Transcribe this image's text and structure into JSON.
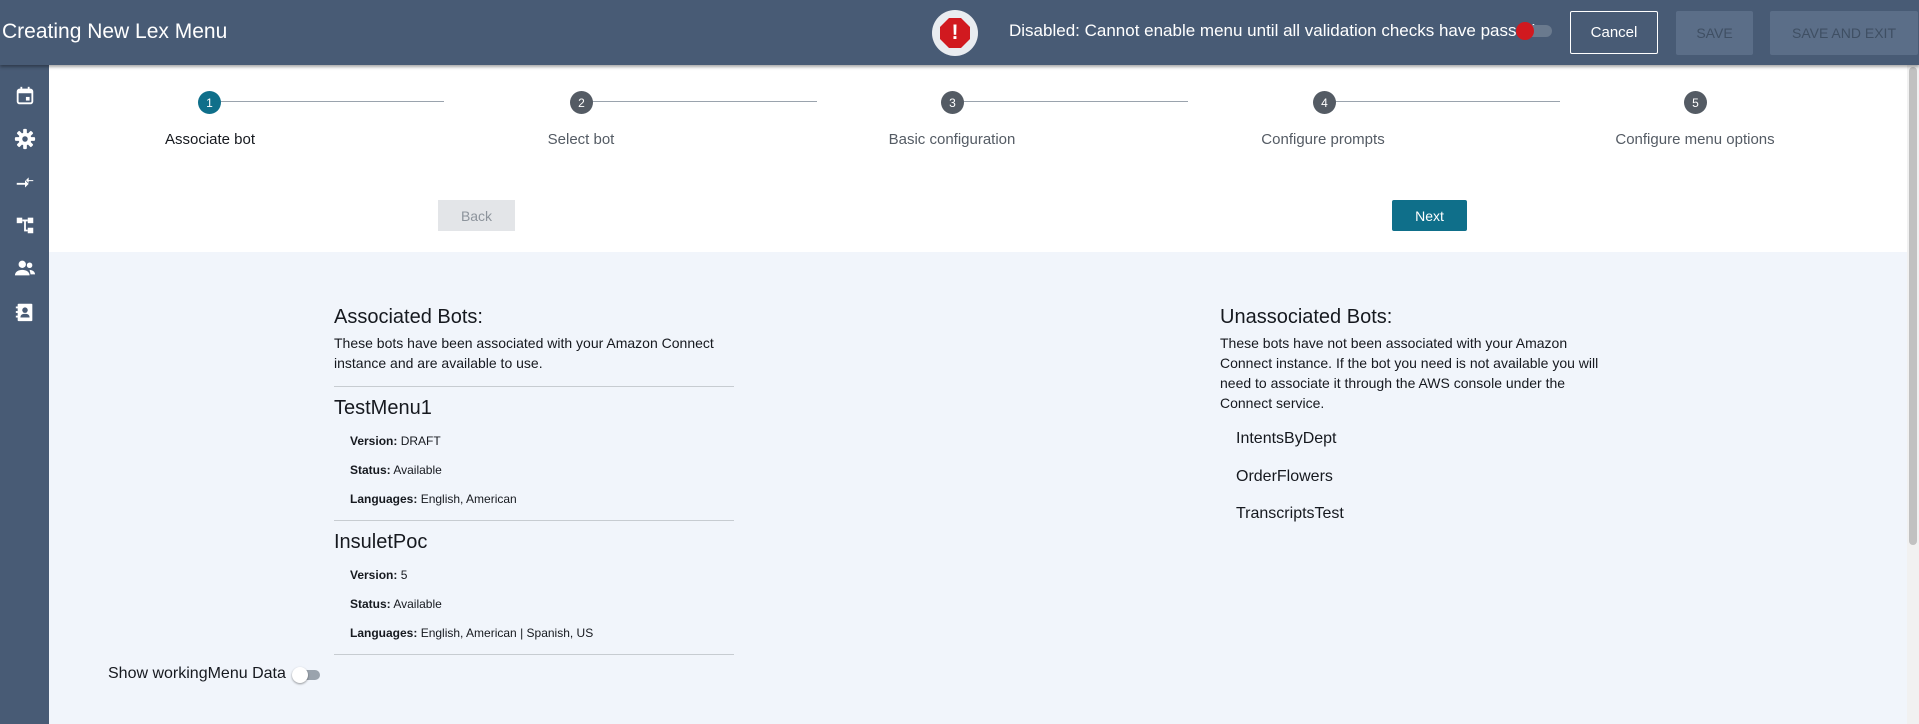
{
  "header": {
    "title": "Creating New Lex Menu",
    "status_text": "Disabled: Cannot enable menu until all validation checks have passed",
    "warning_glyph": "!",
    "cancel_label": "Cancel",
    "save_label": "SAVE",
    "save_exit_label": "SAVE AND EXIT",
    "enable_toggle_on": false
  },
  "sidebar": {
    "icons": [
      "calendar-icon",
      "gear-icon",
      "transfer-icon",
      "flow-icon",
      "users-icon",
      "contact-card-icon"
    ]
  },
  "stepper": {
    "steps": [
      {
        "number": "1",
        "label": "Associate bot",
        "active": true
      },
      {
        "number": "2",
        "label": "Select bot",
        "active": false
      },
      {
        "number": "3",
        "label": "Basic configuration",
        "active": false
      },
      {
        "number": "4",
        "label": "Configure prompts",
        "active": false
      },
      {
        "number": "5",
        "label": "Configure menu options",
        "active": false
      }
    ],
    "back_label": "Back",
    "next_label": "Next"
  },
  "associated": {
    "title": "Associated Bots:",
    "description": "These bots have been associated with your Amazon Connect instance and are available to use.",
    "bots": [
      {
        "name": "TestMenu1",
        "version_label": "Version:",
        "version": "DRAFT",
        "status_label": "Status:",
        "status": "Available",
        "languages_label": "Languages:",
        "languages": "English, American"
      },
      {
        "name": "InsuletPoc",
        "version_label": "Version:",
        "version": "5",
        "status_label": "Status:",
        "status": "Available",
        "languages_label": "Languages:",
        "languages": "English, American | Spanish, US"
      }
    ]
  },
  "unassociated": {
    "title": "Unassociated Bots:",
    "description": "These bots have not been associated with your Amazon Connect instance. If the bot you need is not available you will need to associate it through the AWS console under the Connect service.",
    "bots": [
      "IntentsByDept",
      "OrderFlowers",
      "TranscriptsTest"
    ]
  },
  "footer": {
    "show_working_label": "Show workingMenu Data",
    "toggle_on": false
  },
  "colors": {
    "header_bg": "#485b75",
    "accent": "#0f6f8a",
    "warning": "#d1191f",
    "content_bg": "#f1f5fb"
  }
}
